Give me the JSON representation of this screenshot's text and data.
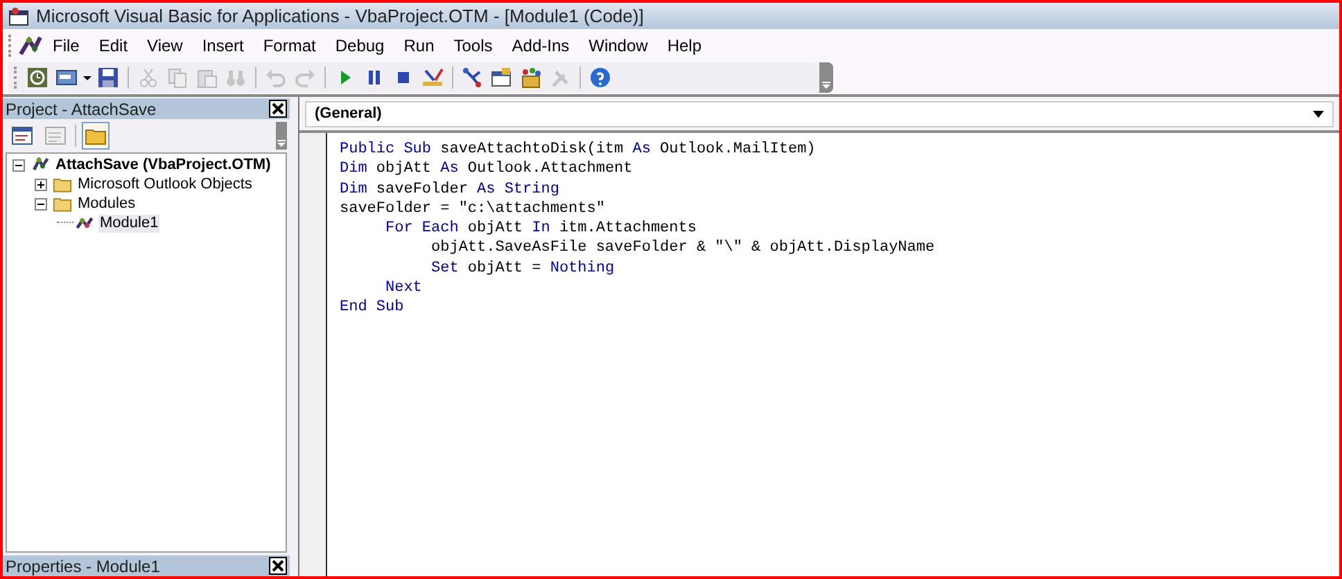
{
  "window": {
    "title": "Microsoft Visual Basic for Applications - VbaProject.OTM - [Module1 (Code)]"
  },
  "menu": [
    {
      "label": "File"
    },
    {
      "label": "Edit"
    },
    {
      "label": "View"
    },
    {
      "label": "Insert"
    },
    {
      "label": "Format"
    },
    {
      "label": "Debug"
    },
    {
      "label": "Run"
    },
    {
      "label": "Tools"
    },
    {
      "label": "Add-Ins"
    },
    {
      "label": "Window"
    },
    {
      "label": "Help"
    }
  ],
  "toolbar": [
    {
      "kind": "view-excel",
      "disabled": false
    },
    {
      "kind": "insert",
      "disabled": false
    },
    {
      "kind": "save",
      "disabled": false
    },
    {
      "kind": "sep"
    },
    {
      "kind": "cut",
      "disabled": true
    },
    {
      "kind": "copy",
      "disabled": true
    },
    {
      "kind": "paste",
      "disabled": true
    },
    {
      "kind": "find",
      "disabled": true
    },
    {
      "kind": "sep"
    },
    {
      "kind": "undo",
      "disabled": true
    },
    {
      "kind": "redo",
      "disabled": true
    },
    {
      "kind": "sep"
    },
    {
      "kind": "run",
      "disabled": false
    },
    {
      "kind": "pause",
      "disabled": false
    },
    {
      "kind": "stop",
      "disabled": false
    },
    {
      "kind": "design",
      "disabled": false
    },
    {
      "kind": "sep"
    },
    {
      "kind": "explorer",
      "disabled": false
    },
    {
      "kind": "properties",
      "disabled": false
    },
    {
      "kind": "browser",
      "disabled": false
    },
    {
      "kind": "toolbox",
      "disabled": true
    },
    {
      "kind": "sep"
    },
    {
      "kind": "help",
      "disabled": false
    }
  ],
  "project_panel": {
    "title": "Project - AttachSave",
    "buttons": [
      {
        "kind": "view-code",
        "selected": false
      },
      {
        "kind": "view-object",
        "selected": false
      },
      {
        "kind": "toggle-folders",
        "selected": true
      }
    ],
    "tree": [
      {
        "label": "AttachSave (VbaProject.OTM)",
        "kind": "project",
        "expanded": true,
        "children": [
          {
            "label": "Microsoft Outlook Objects",
            "kind": "folder",
            "expanded": false
          },
          {
            "label": "Modules",
            "kind": "folder",
            "expanded": true,
            "children": [
              {
                "label": "Module1",
                "kind": "module",
                "selected": true
              }
            ]
          }
        ]
      }
    ]
  },
  "properties_panel": {
    "title": "Properties - Module1"
  },
  "code_window": {
    "object_dropdown": "(General)",
    "lines": [
      [
        {
          "text": "Public Sub",
          "kind": "keyword"
        },
        {
          "text": " saveAttachtoDisk(itm ",
          "kind": "plain"
        },
        {
          "text": "As",
          "kind": "keyword"
        },
        {
          "text": " Outlook.MailItem)",
          "kind": "plain"
        }
      ],
      [
        {
          "text": "Dim",
          "kind": "keyword"
        },
        {
          "text": " objAtt ",
          "kind": "plain"
        },
        {
          "text": "As",
          "kind": "keyword"
        },
        {
          "text": " Outlook.Attachment",
          "kind": "plain"
        }
      ],
      [
        {
          "text": "Dim",
          "kind": "keyword"
        },
        {
          "text": " saveFolder ",
          "kind": "plain"
        },
        {
          "text": "As String",
          "kind": "keyword"
        }
      ],
      [
        {
          "text": "saveFolder = \"c:\\attachments\"",
          "kind": "plain"
        }
      ],
      [
        {
          "text": "     For Each",
          "kind": "keyword"
        },
        {
          "text": " objAtt ",
          "kind": "plain"
        },
        {
          "text": "In",
          "kind": "keyword"
        },
        {
          "text": " itm.Attachments",
          "kind": "plain"
        }
      ],
      [
        {
          "text": "          objAtt.SaveAsFile saveFolder & \"\\\" & objAtt.DisplayName",
          "kind": "plain"
        }
      ],
      [
        {
          "text": "          Set",
          "kind": "keyword"
        },
        {
          "text": " objAtt = ",
          "kind": "plain"
        },
        {
          "text": "Nothing",
          "kind": "keyword"
        }
      ],
      [
        {
          "text": "     Next",
          "kind": "keyword"
        }
      ],
      [
        {
          "text": "End Sub",
          "kind": "keyword"
        }
      ]
    ]
  }
}
